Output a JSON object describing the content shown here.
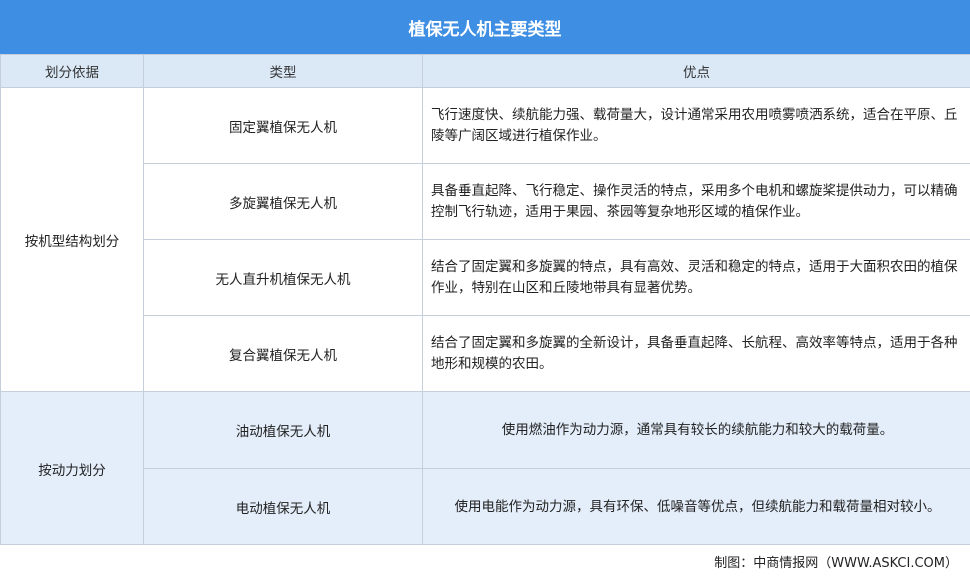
{
  "title": "植保无人机主要类型",
  "headers": {
    "basis": "划分依据",
    "type": "类型",
    "advantage": "优点"
  },
  "groups": [
    {
      "basis": "按机型结构划分",
      "rows": [
        {
          "type": "固定翼植保无人机",
          "advantage": "飞行速度快、续航能力强、载荷量大，设计通常采用农用喷雾喷洒系统，适合在平原、丘陵等广阔区域进行植保作业。"
        },
        {
          "type": "多旋翼植保无人机",
          "advantage": "具备垂直起降、飞行稳定、操作灵活的特点，采用多个电机和螺旋桨提供动力，可以精确控制飞行轨迹，适用于果园、茶园等复杂地形区域的植保作业。"
        },
        {
          "type": "无人直升机植保无人机",
          "advantage": "结合了固定翼和多旋翼的特点，具有高效、灵活和稳定的特点，适用于大面积农田的植保作业，特别在山区和丘陵地带具有显著优势。"
        },
        {
          "type": "复合翼植保无人机",
          "advantage": "结合了固定翼和多旋翼的全新设计，具备垂直起降、长航程、高效率等特点，适用于各种地形和规模的农田。"
        }
      ]
    },
    {
      "basis": "按动力划分",
      "rows": [
        {
          "type": "油动植保无人机",
          "advantage": "使用燃油作为动力源，通常具有较长的续航能力和较大的载荷量。"
        },
        {
          "type": "电动植保无人机",
          "advantage": "使用电能作为动力源，具有环保、低噪音等优点，但续航能力和载荷量相对较小。"
        }
      ]
    }
  ],
  "footer": "制图：中商情报网（WWW.ASKCI.COM）",
  "colors": {
    "title_bg": "#3e8ee3",
    "header_bg": "#dbe9f7",
    "group2_bg": "#e4eefa",
    "border": "#c4cfdb"
  }
}
